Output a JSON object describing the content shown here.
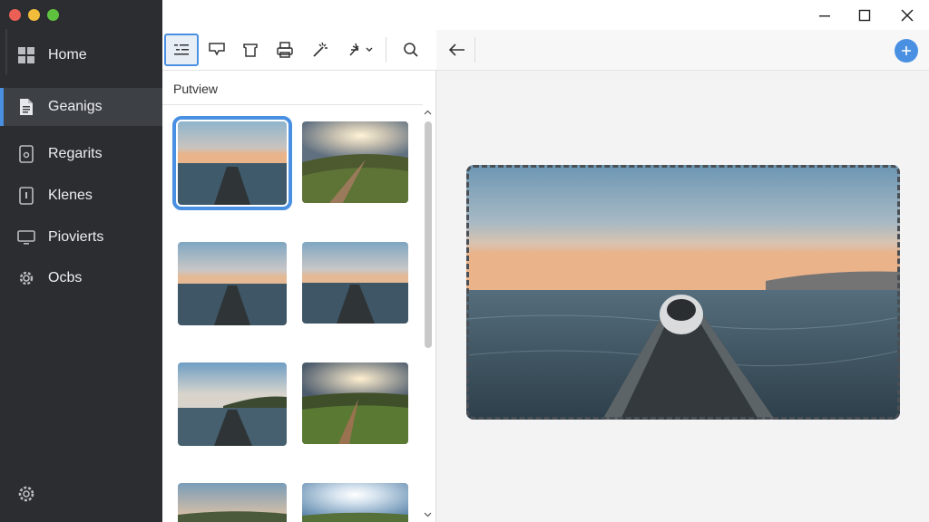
{
  "sidebar": {
    "items": [
      {
        "label": "Home",
        "icon": "grid-icon"
      },
      {
        "label": "Geanigs",
        "icon": "document-icon"
      },
      {
        "label": "Regarits",
        "icon": "device-icon"
      },
      {
        "label": "Klenes",
        "icon": "panel-icon"
      },
      {
        "label": "Piovierts",
        "icon": "monitor-icon"
      },
      {
        "label": "Ocbs",
        "icon": "gear-icon"
      }
    ],
    "active_index": 1
  },
  "toolbar": {
    "tools": [
      "list-settings-icon",
      "annotate-icon",
      "crop-icon",
      "print-icon",
      "magic-wand-icon",
      "effects-icon",
      "search-icon"
    ]
  },
  "panel": {
    "title": "Putview"
  },
  "colors": {
    "accent": "#4a90e2",
    "sidebar_bg": "#2b2d30",
    "sidebar_active": "#3d4045"
  }
}
